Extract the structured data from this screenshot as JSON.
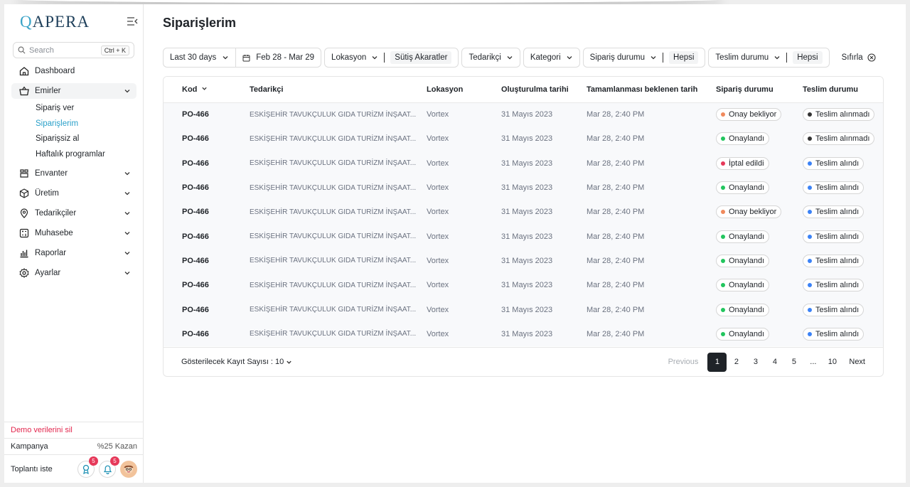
{
  "brand": {
    "logo_q": "Q",
    "logo_rest": "APERA"
  },
  "search": {
    "placeholder": "Search",
    "shortcut": "Ctrl + K"
  },
  "sidebar": {
    "items": [
      {
        "label": "Dashboard",
        "icon": "home-icon"
      },
      {
        "label": "Emirler",
        "icon": "basket-icon"
      },
      {
        "label": "Envanter",
        "icon": "inventory-icon"
      },
      {
        "label": "Üretim",
        "icon": "cube-icon"
      },
      {
        "label": "Tedarikçiler",
        "icon": "location-icon"
      },
      {
        "label": "Muhasebe",
        "icon": "calculator-icon"
      },
      {
        "label": "Raporlar",
        "icon": "chart-icon"
      },
      {
        "label": "Ayarlar",
        "icon": "gear-icon"
      }
    ],
    "sub_items": [
      "Sipariş ver",
      "Siparişlerim",
      "Siparişsiz al",
      "Haftalık programlar"
    ],
    "demo": "Demo verilerini sil",
    "campaign_label": "Kampanya",
    "campaign_value": "%25 Kazan",
    "meeting": "Toplantı iste",
    "badge_award": "5",
    "badge_bell": "5"
  },
  "page": {
    "title": "Siparişlerim"
  },
  "filters": {
    "range": "Last 30 days",
    "dates": "Feb 28 - Mar 29",
    "location_label": "Lokasyon",
    "location_value": "Sütiş Akaratler",
    "supplier": "Tedarikçi",
    "category": "Kategori",
    "order_status_label": "Sipariş durumu",
    "order_status_value": "Hepsi",
    "delivery_status_label": "Teslim durumu",
    "delivery_status_value": "Hepsi",
    "reset": "Sıfırla"
  },
  "table": {
    "headers": [
      "Kod",
      "Tedarikçi",
      "Lokasyon",
      "Oluşturulma tarihi",
      "Tamamlanması beklenen tarih",
      "Sipariş durumu",
      "Teslim durumu"
    ],
    "rows": [
      {
        "kod": "PO-466",
        "supplier": "ESKİŞEHİR TAVUKÇULUK GIDA TURİZM İNŞAAT...",
        "location": "Vortex",
        "created": "31 Mayıs 2023",
        "expected": "Mar 28, 2:40 PM",
        "order_status": "Onay bekliyor",
        "order_color": "#f08a5d",
        "delivery": "Teslim alınmadı",
        "delivery_color": "#333333"
      },
      {
        "kod": "PO-466",
        "supplier": "ESKİŞEHİR TAVUKÇULUK GIDA TURİZM İNŞAAT...",
        "location": "Vortex",
        "created": "31 Mayıs 2023",
        "expected": "Mar 28, 2:40 PM",
        "order_status": "Onaylandı",
        "order_color": "#22c55e",
        "delivery": "Teslim alınmadı",
        "delivery_color": "#333333"
      },
      {
        "kod": "PO-466",
        "supplier": "ESKİŞEHİR TAVUKÇULUK GIDA TURİZM İNŞAAT...",
        "location": "Vortex",
        "created": "31 Mayıs 2023",
        "expected": "Mar 28, 2:40 PM",
        "order_status": "İptal edildi",
        "order_color": "#e6395a",
        "delivery": "Teslim alındı",
        "delivery_color": "#3b82f6"
      },
      {
        "kod": "PO-466",
        "supplier": "ESKİŞEHİR TAVUKÇULUK GIDA TURİZM İNŞAAT...",
        "location": "Vortex",
        "created": "31 Mayıs 2023",
        "expected": "Mar 28, 2:40 PM",
        "order_status": "Onaylandı",
        "order_color": "#22c55e",
        "delivery": "Teslim alındı",
        "delivery_color": "#3b82f6"
      },
      {
        "kod": "PO-466",
        "supplier": "ESKİŞEHİR TAVUKÇULUK GIDA TURİZM İNŞAAT...",
        "location": "Vortex",
        "created": "31 Mayıs 2023",
        "expected": "Mar 28, 2:40 PM",
        "order_status": "Onay bekliyor",
        "order_color": "#f08a5d",
        "delivery": "Teslim alındı",
        "delivery_color": "#3b82f6"
      },
      {
        "kod": "PO-466",
        "supplier": "ESKİŞEHİR TAVUKÇULUK GIDA TURİZM İNŞAAT...",
        "location": "Vortex",
        "created": "31 Mayıs 2023",
        "expected": "Mar 28, 2:40 PM",
        "order_status": "Onaylandı",
        "order_color": "#22c55e",
        "delivery": "Teslim alındı",
        "delivery_color": "#3b82f6"
      },
      {
        "kod": "PO-466",
        "supplier": "ESKİŞEHİR TAVUKÇULUK GIDA TURİZM İNŞAAT...",
        "location": "Vortex",
        "created": "31 Mayıs 2023",
        "expected": "Mar 28, 2:40 PM",
        "order_status": "Onaylandı",
        "order_color": "#22c55e",
        "delivery": "Teslim alındı",
        "delivery_color": "#3b82f6"
      },
      {
        "kod": "PO-466",
        "supplier": "ESKİŞEHİR TAVUKÇULUK GIDA TURİZM İNŞAAT...",
        "location": "Vortex",
        "created": "31 Mayıs 2023",
        "expected": "Mar 28, 2:40 PM",
        "order_status": "Onaylandı",
        "order_color": "#22c55e",
        "delivery": "Teslim alındı",
        "delivery_color": "#3b82f6"
      },
      {
        "kod": "PO-466",
        "supplier": "ESKİŞEHİR TAVUKÇULUK GIDA TURİZM İNŞAAT...",
        "location": "Vortex",
        "created": "31 Mayıs 2023",
        "expected": "Mar 28, 2:40 PM",
        "order_status": "Onaylandı",
        "order_color": "#22c55e",
        "delivery": "Teslim alındı",
        "delivery_color": "#3b82f6"
      },
      {
        "kod": "PO-466",
        "supplier": "ESKİŞEHİR TAVUKÇULUK GIDA TURİZM İNŞAAT...",
        "location": "Vortex",
        "created": "31 Mayıs 2023",
        "expected": "Mar 28, 2:40 PM",
        "order_status": "Onaylandı",
        "order_color": "#22c55e",
        "delivery": "Teslim alındı",
        "delivery_color": "#3b82f6"
      }
    ]
  },
  "footer": {
    "per_page": "Gösterilecek Kayıt Sayısı : 10",
    "previous": "Previous",
    "pages": [
      "1",
      "2",
      "3",
      "4",
      "5",
      "...",
      "10"
    ],
    "current_page": "1",
    "next": "Next"
  }
}
